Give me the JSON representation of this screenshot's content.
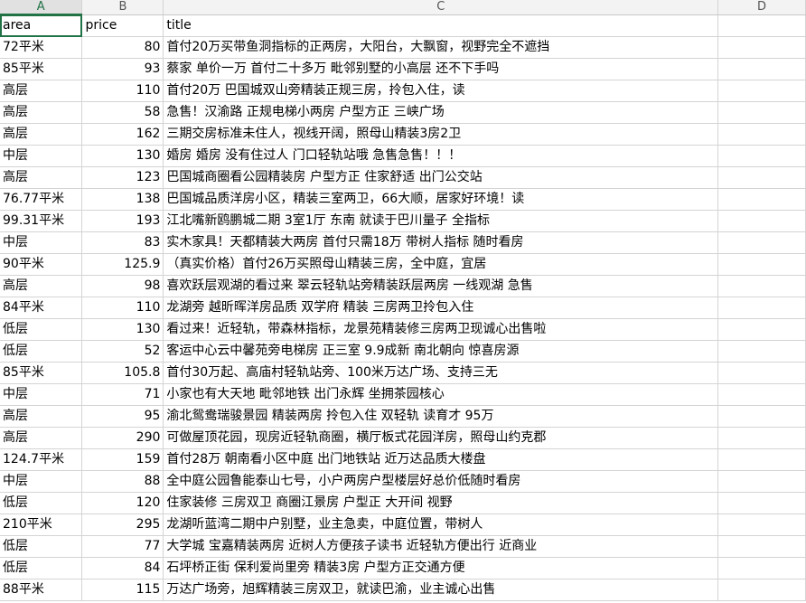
{
  "columns": [
    "A",
    "B",
    "C",
    "D"
  ],
  "headers": {
    "area": "area",
    "price": "price",
    "title": "title"
  },
  "rows": [
    {
      "area": "72平米",
      "price": "80",
      "title": "首付20万买带鱼洞指标的正两房，大阳台，大飘窗，视野完全不遮挡"
    },
    {
      "area": "85平米",
      "price": "93",
      "title": "蔡家 单价一万 首付二十多万 毗邻别墅的小高层 还不下手吗"
    },
    {
      "area": "高层",
      "price": "110",
      "title": "首付20万 巴国城双山旁精装正规三房，拎包入住，读"
    },
    {
      "area": "高层",
      "price": "58",
      "title": "急售！汉渝路 正规电梯小两房 户型方正 三峡广场"
    },
    {
      "area": "高层",
      "price": "162",
      "title": "三期交房标准未住人，视线开阔，照母山精装3房2卫"
    },
    {
      "area": "中层",
      "price": "130",
      "title": "婚房 婚房 没有住过人 门口轻轨站哦 急售急售！！！"
    },
    {
      "area": "高层",
      "price": "123",
      "title": "巴国城商圈看公园精装房 户型方正 住家舒适 出门公交站"
    },
    {
      "area": "76.77平米",
      "price": "138",
      "title": "巴国城品质洋房小区，精装三室两卫，66大顺，居家好环境！读"
    },
    {
      "area": "99.31平米",
      "price": "193",
      "title": "江北嘴新鸥鹏城二期 3室1厅 东南 就读于巴川量子 全指标"
    },
    {
      "area": "中层",
      "price": "83",
      "title": "实木家具！天都精装大两房 首付只需18万 带树人指标 随时看房"
    },
    {
      "area": "90平米",
      "price": "125.9",
      "title": "（真实价格）首付26万买照母山精装三房，全中庭，宜居"
    },
    {
      "area": "高层",
      "price": "98",
      "title": "喜欢跃层观湖的看过来 翠云轻轨站旁精装跃层两房 一线观湖 急售"
    },
    {
      "area": "84平米",
      "price": "110",
      "title": "龙湖旁 越昕晖洋房品质 双学府 精装 三房两卫拎包入住"
    },
    {
      "area": "低层",
      "price": "130",
      "title": "看过来！近轻轨，带森林指标，龙景苑精装修三房两卫现诚心出售啦"
    },
    {
      "area": "低层",
      "price": "52",
      "title": "客运中心云中馨苑旁电梯房 正三室 9.9成新 南北朝向 惊喜房源"
    },
    {
      "area": "85平米",
      "price": "105.8",
      "title": "首付30万起、高庙村轻轨站旁、100米万达广场、支持三无"
    },
    {
      "area": "中层",
      "price": "71",
      "title": "小家也有大天地 毗邻地铁 出门永辉 坐拥茶园核心"
    },
    {
      "area": "高层",
      "price": "95",
      "title": "渝北鸳鸯瑞骏景园 精装两房 拎包入住 双轻轨 读育才 95万"
    },
    {
      "area": "高层",
      "price": "290",
      "title": "可做屋顶花园，现房近轻轨商圈，横厅板式花园洋房，照母山约克郡"
    },
    {
      "area": "124.7平米",
      "price": "159",
      "title": "首付28万 朝南看小区中庭 出门地铁站 近万达品质大楼盘"
    },
    {
      "area": "中层",
      "price": "88",
      "title": "全中庭公园鲁能泰山七号，小户两房户型楼层好总价低随时看房"
    },
    {
      "area": "低层",
      "price": "120",
      "title": "住家装修 三房双卫 商圈江景房 户型正 大开间 视野"
    },
    {
      "area": "210平米",
      "price": "295",
      "title": "龙湖听蓝湾二期中户别墅，业主急卖，中庭位置，带树人"
    },
    {
      "area": "低层",
      "price": "77",
      "title": "大学城 宝嘉精装两房 近树人方便孩子读书 近轻轨方便出行 近商业"
    },
    {
      "area": "低层",
      "price": "84",
      "title": "石坪桥正街 保利爱尚里旁 精装3房 户型方正交通方便"
    },
    {
      "area": "88平米",
      "price": "115",
      "title": "万达广场旁，旭辉精装三房双卫，就读巴渝，业主诚心出售"
    }
  ]
}
